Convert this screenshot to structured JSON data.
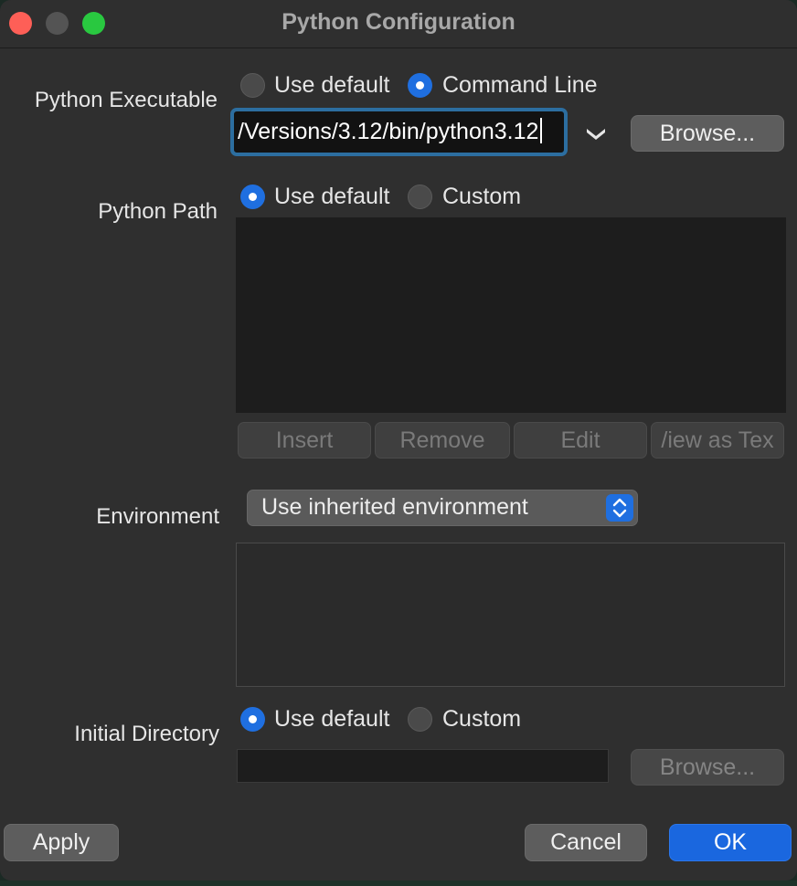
{
  "window": {
    "title": "Python Configuration"
  },
  "python_executable": {
    "label": "Python Executable",
    "options": [
      "Use default",
      "Command Line"
    ],
    "selected": "Command Line",
    "value": "/Versions/3.12/bin/python3.12",
    "browse_label": "Browse..."
  },
  "python_path": {
    "label": "Python Path",
    "options": [
      "Use default",
      "Custom"
    ],
    "selected": "Use default",
    "buttons": {
      "insert": "Insert",
      "remove": "Remove",
      "edit": "Edit",
      "view_as_text": "/iew as Tex"
    }
  },
  "environment": {
    "label": "Environment",
    "selected": "Use inherited environment"
  },
  "initial_directory": {
    "label": "Initial Directory",
    "options": [
      "Use default",
      "Custom"
    ],
    "selected": "Use default",
    "browse_label": "Browse..."
  },
  "footer": {
    "apply": "Apply",
    "cancel": "Cancel",
    "ok": "OK"
  },
  "colors": {
    "accent": "#1f6fe0",
    "window_bg": "#2f2f2f",
    "input_focus": "#2c6ea0"
  }
}
